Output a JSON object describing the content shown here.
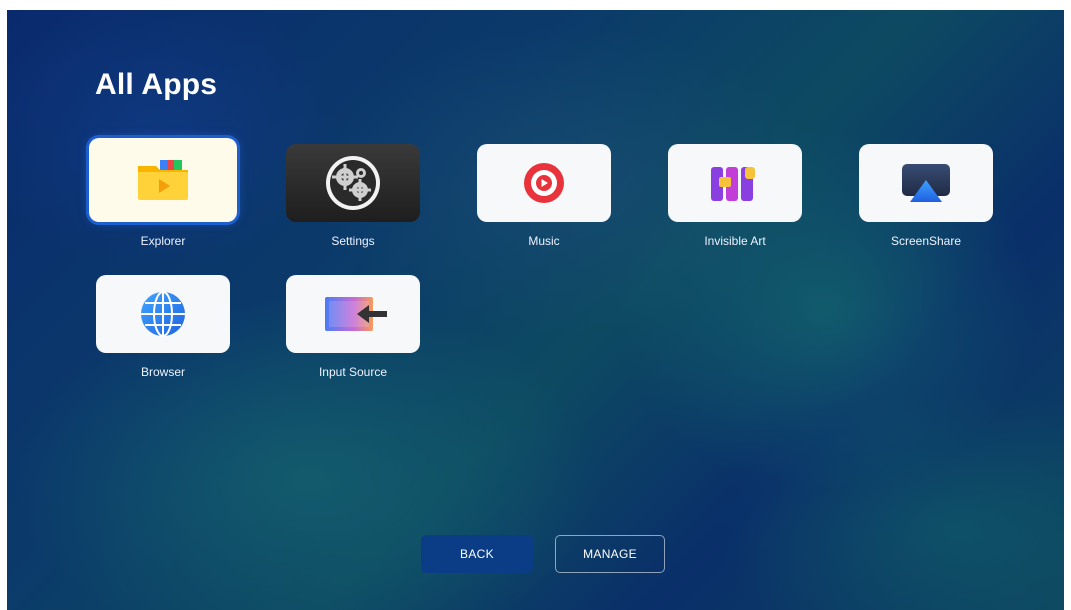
{
  "page": {
    "title": "All Apps"
  },
  "apps": [
    {
      "label": "Explorer",
      "icon": "folder-icon",
      "focused": true
    },
    {
      "label": "Settings",
      "icon": "gear-icon"
    },
    {
      "label": "Music",
      "icon": "music-play-icon"
    },
    {
      "label": "Invisible Art",
      "icon": "invisible-art-icon"
    },
    {
      "label": "ScreenShare",
      "icon": "screen-share-icon"
    },
    {
      "label": "Browser",
      "icon": "globe-icon"
    },
    {
      "label": "Input Source",
      "icon": "input-source-icon"
    }
  ],
  "buttons": {
    "back": "BACK",
    "manage": "MANAGE"
  },
  "colors": {
    "focus_ring": "#1e5fd0",
    "back_button": "#0b3c86",
    "music_red": "#e8323c",
    "art_purple": "#8a3fe0",
    "art_yellow": "#f6c23a"
  }
}
